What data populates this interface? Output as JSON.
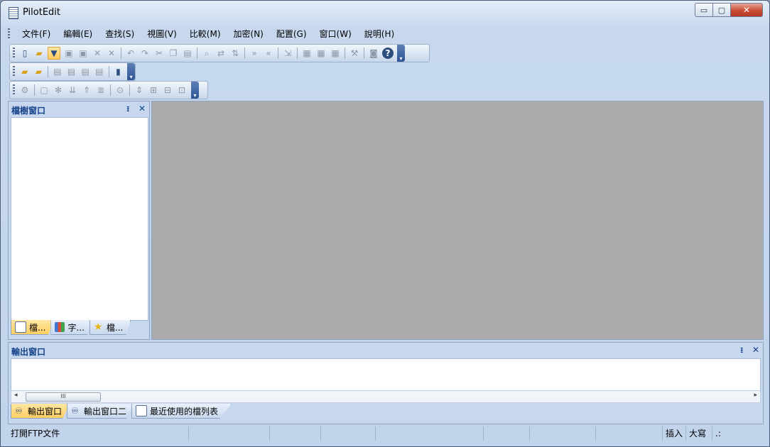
{
  "window": {
    "title": "PilotEdit",
    "icon": "document-icon"
  },
  "titlebar_buttons": {
    "minimize": "▭",
    "maximize": "▢",
    "close": "✕"
  },
  "menu": [
    "文件(F)",
    "編輯(E)",
    "查找(S)",
    "視圖(V)",
    "比較(M)",
    "加密(N)",
    "配置(G)",
    "窗口(W)",
    "說明(H)"
  ],
  "toolbar1": [
    "new-file-icon",
    "open-folder-icon",
    "open-ftp-icon",
    "save-icon",
    "save-all-icon",
    "close-icon",
    "close-all-icon",
    "undo-icon",
    "redo-icon",
    "cut-icon",
    "copy-icon",
    "paste-icon",
    "find-icon",
    "replace-icon",
    "sort-icon",
    "next-icon",
    "previous-icon",
    "goto-icon",
    "grid1-icon",
    "grid2-icon",
    "grid3-icon",
    "tools-icon",
    "record-icon",
    "help-icon"
  ],
  "toolbar2": [
    "ftp-connect-icon",
    "ftp-disconnect-icon",
    "ftp-a-icon",
    "ftp-b-icon",
    "ftp-c-icon",
    "ftp-d-icon",
    "ftp-lock-icon"
  ],
  "toolbar3": [
    "settings-icon",
    "new-folder-icon",
    "gear-icon",
    "sort-az-icon",
    "move-up-icon",
    "indent-icon",
    "zoom-icon",
    "expand-icon",
    "plus-icon",
    "minus-icon",
    "collapse-icon"
  ],
  "file_tree": {
    "title": "檔樹窗口",
    "pin": "ᵻ",
    "close": "✕",
    "tabs": [
      "檔...",
      "字...",
      "檔..."
    ]
  },
  "output": {
    "title": "輸出窗口",
    "pin": "ᵻ",
    "close": "✕",
    "scroll_thumb": "III",
    "left_arrow": "◂",
    "right_arrow": "▸",
    "tabs": [
      "輸出窗口",
      "輸出窗口二",
      "最近使用的檔列表"
    ]
  },
  "statusbar": {
    "message": "打開FTP文件",
    "insert": "插入",
    "width": "大寫",
    "grip": ".:"
  }
}
